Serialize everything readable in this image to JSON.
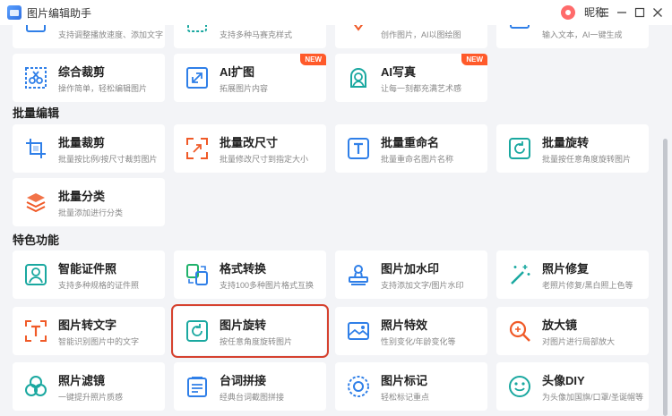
{
  "app": {
    "title": "图片编辑助手",
    "user_name": "昵称"
  },
  "sections": {
    "batch": "批量编辑",
    "special": "特色功能"
  },
  "top_partial": [
    {
      "desc": "支持调整播放速度、添加文字"
    },
    {
      "desc": "支持多种马赛克样式"
    },
    {
      "desc": "创作图片，AI以图绘图"
    },
    {
      "desc": "输入文本，AI一键生成"
    }
  ],
  "row_ai": [
    {
      "title": "综合裁剪",
      "desc": "操作简单，轻松编辑图片",
      "icon": "crop-scissors-icon"
    },
    {
      "title": "AI扩图",
      "desc": "拓展图片内容",
      "icon": "expand-arrows-icon",
      "badge": "NEW"
    },
    {
      "title": "AI写真",
      "desc": "让每一刻都充满艺术感",
      "icon": "portrait-icon",
      "badge": "NEW"
    }
  ],
  "batch_cards": [
    {
      "title": "批量裁剪",
      "desc": "批量按比例/按尺寸裁剪图片",
      "icon": "batch-crop-icon"
    },
    {
      "title": "批量改尺寸",
      "desc": "批量修改尺寸到指定大小",
      "icon": "resize-icon"
    },
    {
      "title": "批量重命名",
      "desc": "批量重命名图片名称",
      "icon": "rename-icon"
    },
    {
      "title": "批量旋转",
      "desc": "批量按任意角度旋转图片",
      "icon": "batch-rotate-icon"
    },
    {
      "title": "批量分类",
      "desc": "批量添加进行分类",
      "icon": "layers-icon"
    }
  ],
  "special_cards": [
    {
      "title": "智能证件照",
      "desc": "支持多种规格的证件照",
      "icon": "id-photo-icon"
    },
    {
      "title": "格式转换",
      "desc": "支持100多种图片格式互换",
      "icon": "format-convert-icon"
    },
    {
      "title": "图片加水印",
      "desc": "支持添加文字/图片水印",
      "icon": "watermark-stamp-icon"
    },
    {
      "title": "照片修复",
      "desc": "老照片修复/黑白照上色等",
      "icon": "magic-wand-icon"
    },
    {
      "title": "图片转文字",
      "desc": "智能识别图片中的文字",
      "icon": "ocr-text-icon"
    },
    {
      "title": "图片旋转",
      "desc": "按任意角度旋转图片",
      "icon": "rotate-icon"
    },
    {
      "title": "照片特效",
      "desc": "性别变化/年龄变化等",
      "icon": "photo-effect-icon"
    },
    {
      "title": "放大镜",
      "desc": "对图片进行局部放大",
      "icon": "magnifier-icon"
    },
    {
      "title": "照片滤镜",
      "desc": "一键提升照片质感",
      "icon": "filter-icon"
    },
    {
      "title": "台词拼接",
      "desc": "经典台词截图拼接",
      "icon": "subtitle-icon"
    },
    {
      "title": "图片标记",
      "desc": "轻松标记重点",
      "icon": "mark-icon"
    },
    {
      "title": "头像DIY",
      "desc": "为头像加国旗/口罩/圣诞帽等",
      "icon": "smiley-icon"
    }
  ],
  "colors": {
    "blue": "#2f7fe8",
    "orange": "#f05a28",
    "teal": "#1aa8a0",
    "green": "#20b26b",
    "red_selection": "#d6422f",
    "badge": "#ff5a2a"
  }
}
